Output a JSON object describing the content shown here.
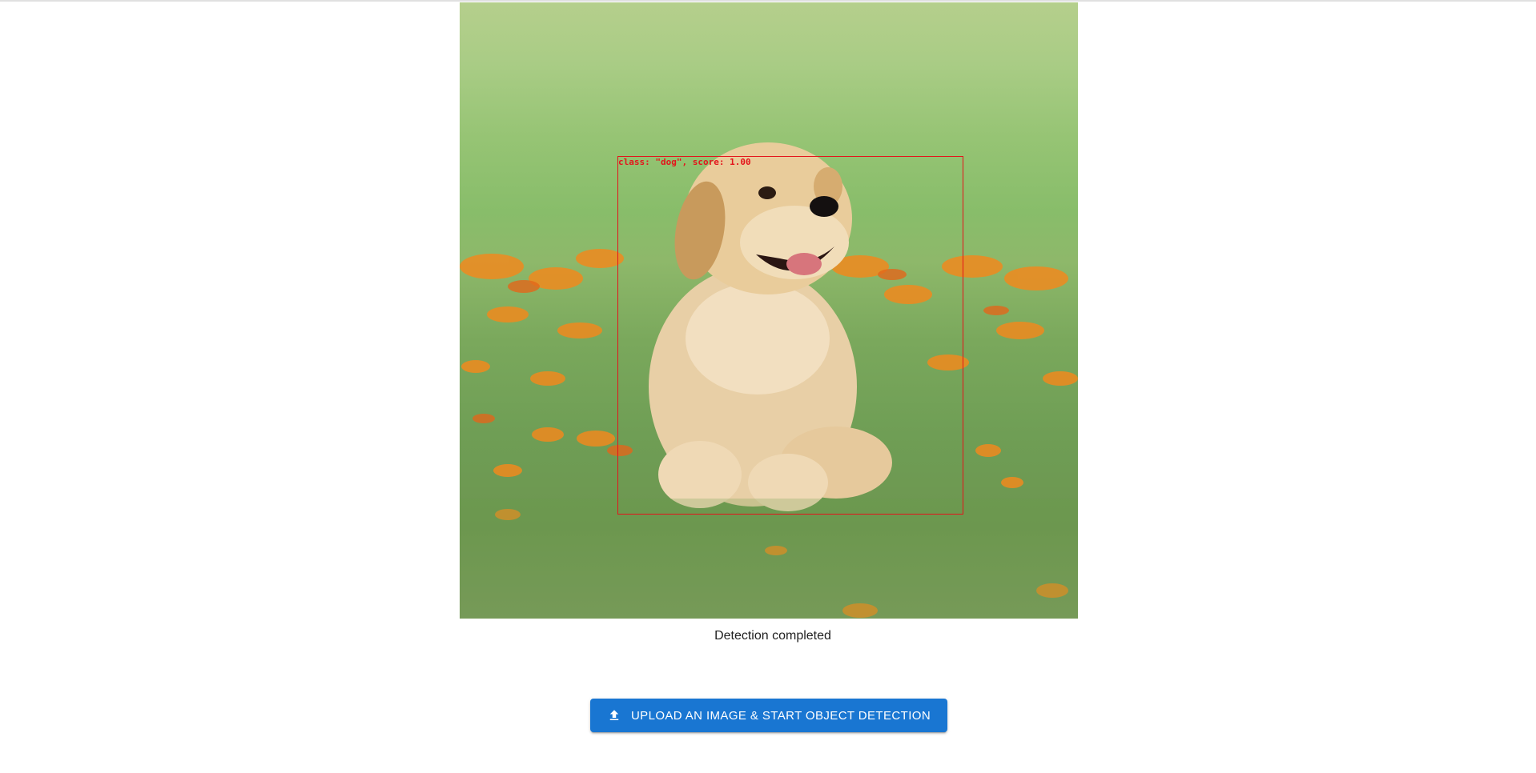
{
  "detection": {
    "box_label": "class: \"dog\", score: 1.00",
    "class_name": "dog",
    "score": 1.0
  },
  "status": {
    "text": "Detection completed"
  },
  "upload_button": {
    "label": "UPLOAD AN IMAGE & START OBJECT DETECTION",
    "icon": "upload-icon"
  },
  "colors": {
    "accent": "#1976d2",
    "bbox": "#e4141b"
  }
}
